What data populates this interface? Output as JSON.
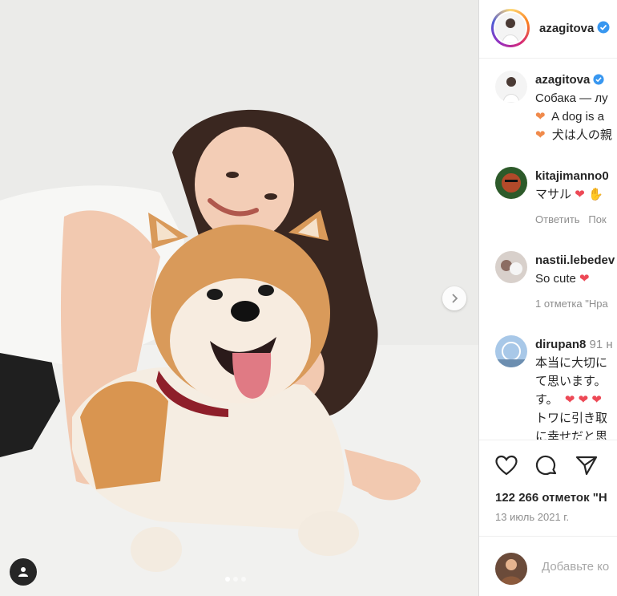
{
  "post": {
    "username": "azagitova",
    "verified": true,
    "carousel": {
      "current": 1,
      "total": 3
    }
  },
  "caption": {
    "username": "azagitova",
    "line1": "Собака — лу",
    "line2": "A dog is a",
    "line3": "犬は人の親"
  },
  "comments": [
    {
      "username": "kitajimanno0",
      "text": "マサル",
      "reply_label": "Ответить",
      "more_label": "Пок"
    },
    {
      "username": "nastii.lebedev",
      "text": "So cute",
      "meta": "1 отметка \"Нра"
    },
    {
      "username": "dirupan8",
      "time": "91 н",
      "lines": [
        "本当に大切に",
        "て思います。",
        "す。",
        "トワに引き取",
        "に幸せだと思"
      ]
    }
  ],
  "stats": {
    "likes": "122 266 отметок \"Н",
    "date": "13 июль 2021 г."
  },
  "add_comment": {
    "placeholder": "Добавьте ко"
  },
  "colors": {
    "verified": "#3897f0",
    "heart": "#ed4956",
    "orange_heart": "#f08a4b",
    "meta_gray": "#8e8e8e"
  }
}
